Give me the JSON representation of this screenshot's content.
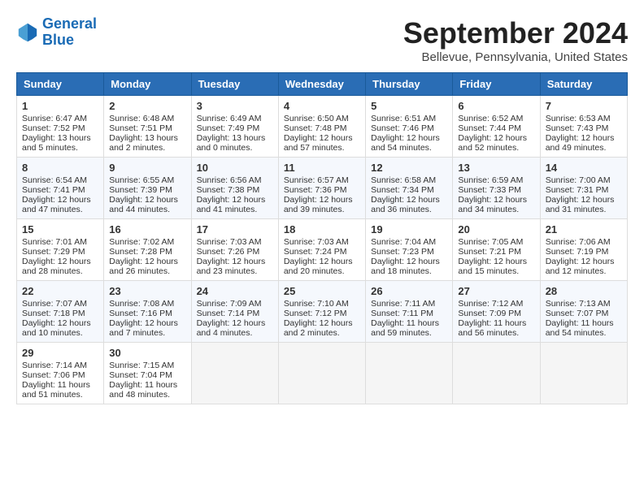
{
  "header": {
    "logo_line1": "General",
    "logo_line2": "Blue",
    "month_title": "September 2024",
    "subtitle": "Bellevue, Pennsylvania, United States"
  },
  "weekdays": [
    "Sunday",
    "Monday",
    "Tuesday",
    "Wednesday",
    "Thursday",
    "Friday",
    "Saturday"
  ],
  "weeks": [
    [
      {
        "day": "1",
        "sunrise": "Sunrise: 6:47 AM",
        "sunset": "Sunset: 7:52 PM",
        "daylight": "Daylight: 13 hours and 5 minutes."
      },
      {
        "day": "2",
        "sunrise": "Sunrise: 6:48 AM",
        "sunset": "Sunset: 7:51 PM",
        "daylight": "Daylight: 13 hours and 2 minutes."
      },
      {
        "day": "3",
        "sunrise": "Sunrise: 6:49 AM",
        "sunset": "Sunset: 7:49 PM",
        "daylight": "Daylight: 13 hours and 0 minutes."
      },
      {
        "day": "4",
        "sunrise": "Sunrise: 6:50 AM",
        "sunset": "Sunset: 7:48 PM",
        "daylight": "Daylight: 12 hours and 57 minutes."
      },
      {
        "day": "5",
        "sunrise": "Sunrise: 6:51 AM",
        "sunset": "Sunset: 7:46 PM",
        "daylight": "Daylight: 12 hours and 54 minutes."
      },
      {
        "day": "6",
        "sunrise": "Sunrise: 6:52 AM",
        "sunset": "Sunset: 7:44 PM",
        "daylight": "Daylight: 12 hours and 52 minutes."
      },
      {
        "day": "7",
        "sunrise": "Sunrise: 6:53 AM",
        "sunset": "Sunset: 7:43 PM",
        "daylight": "Daylight: 12 hours and 49 minutes."
      }
    ],
    [
      {
        "day": "8",
        "sunrise": "Sunrise: 6:54 AM",
        "sunset": "Sunset: 7:41 PM",
        "daylight": "Daylight: 12 hours and 47 minutes."
      },
      {
        "day": "9",
        "sunrise": "Sunrise: 6:55 AM",
        "sunset": "Sunset: 7:39 PM",
        "daylight": "Daylight: 12 hours and 44 minutes."
      },
      {
        "day": "10",
        "sunrise": "Sunrise: 6:56 AM",
        "sunset": "Sunset: 7:38 PM",
        "daylight": "Daylight: 12 hours and 41 minutes."
      },
      {
        "day": "11",
        "sunrise": "Sunrise: 6:57 AM",
        "sunset": "Sunset: 7:36 PM",
        "daylight": "Daylight: 12 hours and 39 minutes."
      },
      {
        "day": "12",
        "sunrise": "Sunrise: 6:58 AM",
        "sunset": "Sunset: 7:34 PM",
        "daylight": "Daylight: 12 hours and 36 minutes."
      },
      {
        "day": "13",
        "sunrise": "Sunrise: 6:59 AM",
        "sunset": "Sunset: 7:33 PM",
        "daylight": "Daylight: 12 hours and 34 minutes."
      },
      {
        "day": "14",
        "sunrise": "Sunrise: 7:00 AM",
        "sunset": "Sunset: 7:31 PM",
        "daylight": "Daylight: 12 hours and 31 minutes."
      }
    ],
    [
      {
        "day": "15",
        "sunrise": "Sunrise: 7:01 AM",
        "sunset": "Sunset: 7:29 PM",
        "daylight": "Daylight: 12 hours and 28 minutes."
      },
      {
        "day": "16",
        "sunrise": "Sunrise: 7:02 AM",
        "sunset": "Sunset: 7:28 PM",
        "daylight": "Daylight: 12 hours and 26 minutes."
      },
      {
        "day": "17",
        "sunrise": "Sunrise: 7:03 AM",
        "sunset": "Sunset: 7:26 PM",
        "daylight": "Daylight: 12 hours and 23 minutes."
      },
      {
        "day": "18",
        "sunrise": "Sunrise: 7:03 AM",
        "sunset": "Sunset: 7:24 PM",
        "daylight": "Daylight: 12 hours and 20 minutes."
      },
      {
        "day": "19",
        "sunrise": "Sunrise: 7:04 AM",
        "sunset": "Sunset: 7:23 PM",
        "daylight": "Daylight: 12 hours and 18 minutes."
      },
      {
        "day": "20",
        "sunrise": "Sunrise: 7:05 AM",
        "sunset": "Sunset: 7:21 PM",
        "daylight": "Daylight: 12 hours and 15 minutes."
      },
      {
        "day": "21",
        "sunrise": "Sunrise: 7:06 AM",
        "sunset": "Sunset: 7:19 PM",
        "daylight": "Daylight: 12 hours and 12 minutes."
      }
    ],
    [
      {
        "day": "22",
        "sunrise": "Sunrise: 7:07 AM",
        "sunset": "Sunset: 7:18 PM",
        "daylight": "Daylight: 12 hours and 10 minutes."
      },
      {
        "day": "23",
        "sunrise": "Sunrise: 7:08 AM",
        "sunset": "Sunset: 7:16 PM",
        "daylight": "Daylight: 12 hours and 7 minutes."
      },
      {
        "day": "24",
        "sunrise": "Sunrise: 7:09 AM",
        "sunset": "Sunset: 7:14 PM",
        "daylight": "Daylight: 12 hours and 4 minutes."
      },
      {
        "day": "25",
        "sunrise": "Sunrise: 7:10 AM",
        "sunset": "Sunset: 7:12 PM",
        "daylight": "Daylight: 12 hours and 2 minutes."
      },
      {
        "day": "26",
        "sunrise": "Sunrise: 7:11 AM",
        "sunset": "Sunset: 7:11 PM",
        "daylight": "Daylight: 11 hours and 59 minutes."
      },
      {
        "day": "27",
        "sunrise": "Sunrise: 7:12 AM",
        "sunset": "Sunset: 7:09 PM",
        "daylight": "Daylight: 11 hours and 56 minutes."
      },
      {
        "day": "28",
        "sunrise": "Sunrise: 7:13 AM",
        "sunset": "Sunset: 7:07 PM",
        "daylight": "Daylight: 11 hours and 54 minutes."
      }
    ],
    [
      {
        "day": "29",
        "sunrise": "Sunrise: 7:14 AM",
        "sunset": "Sunset: 7:06 PM",
        "daylight": "Daylight: 11 hours and 51 minutes."
      },
      {
        "day": "30",
        "sunrise": "Sunrise: 7:15 AM",
        "sunset": "Sunset: 7:04 PM",
        "daylight": "Daylight: 11 hours and 48 minutes."
      },
      null,
      null,
      null,
      null,
      null
    ]
  ]
}
